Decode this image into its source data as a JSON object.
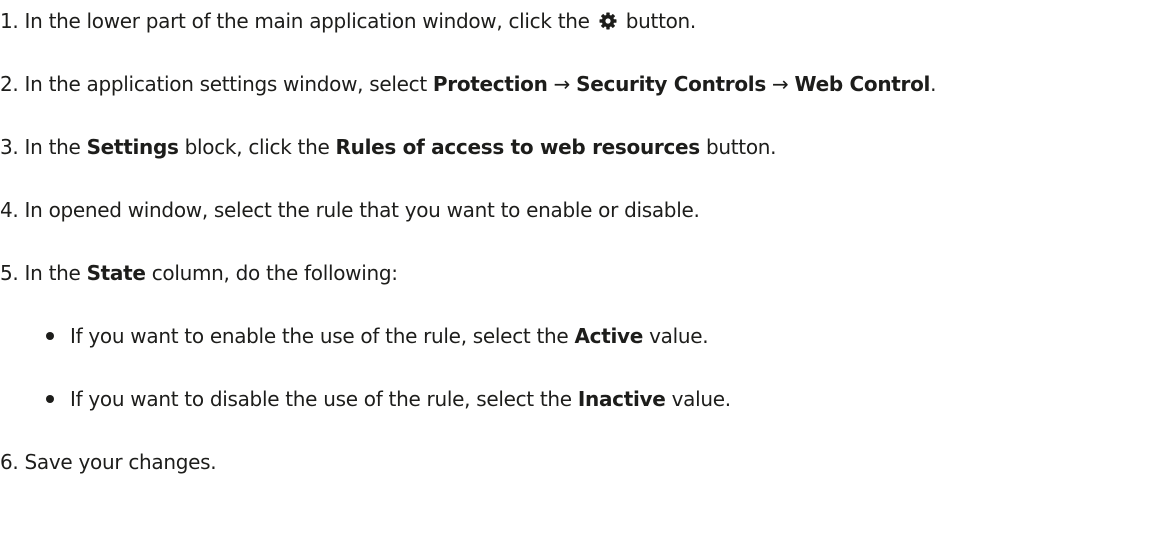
{
  "steps": [
    {
      "number": "1.",
      "before": " In the lower part of the main application window, click the ",
      "icon": "gear-icon",
      "after": " button."
    },
    {
      "number": "2.",
      "before": " In the application settings window, select ",
      "b1": "Protection",
      "arrow1": " → ",
      "b2": "Security Controls",
      "arrow2": " → ",
      "b3": "Web Control",
      "after": "."
    },
    {
      "number": "3.",
      "before": " In the ",
      "b1": "Settings",
      "mid": " block, click the ",
      "b2": "Rules of access to web resources",
      "after": " button."
    },
    {
      "number": "4.",
      "text": " In opened window, select the rule that you want to enable or disable."
    },
    {
      "number": "5.",
      "before": " In the ",
      "b1": "State",
      "after": " column, do the following:"
    },
    {
      "number": "6.",
      "text": " Save your changes."
    }
  ],
  "bullets": [
    {
      "before": "If you want to enable the use of the rule, select the ",
      "bold": "Active",
      "after": " value."
    },
    {
      "before": "If you want to disable the use of the rule, select the ",
      "bold": "Inactive",
      "after": " value."
    }
  ],
  "colors": {
    "text": "#1d1d1b",
    "background": "#ffffff"
  }
}
